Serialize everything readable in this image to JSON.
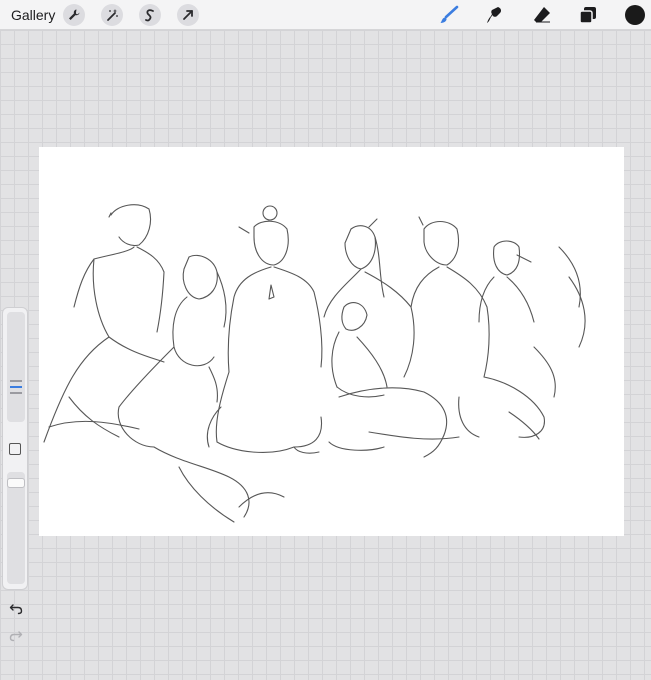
{
  "app": {
    "gallery_label": "Gallery"
  },
  "toolbar_left": [
    {
      "name": "actions-wrench-icon"
    },
    {
      "name": "adjustments-wand-icon"
    },
    {
      "name": "selection-s-icon"
    },
    {
      "name": "transform-arrow-icon"
    }
  ],
  "toolbar_right": [
    {
      "name": "brush-icon",
      "active": true
    },
    {
      "name": "smudge-icon"
    },
    {
      "name": "eraser-icon"
    },
    {
      "name": "layers-icon"
    }
  ],
  "colors": {
    "accent": "#3b7de0",
    "current_color": "#1a1a1a",
    "canvas": "#ffffff",
    "background": "#e2e2e4"
  },
  "sidebar": {
    "brush_size_level": 0.78,
    "opacity_level": 0.06
  }
}
